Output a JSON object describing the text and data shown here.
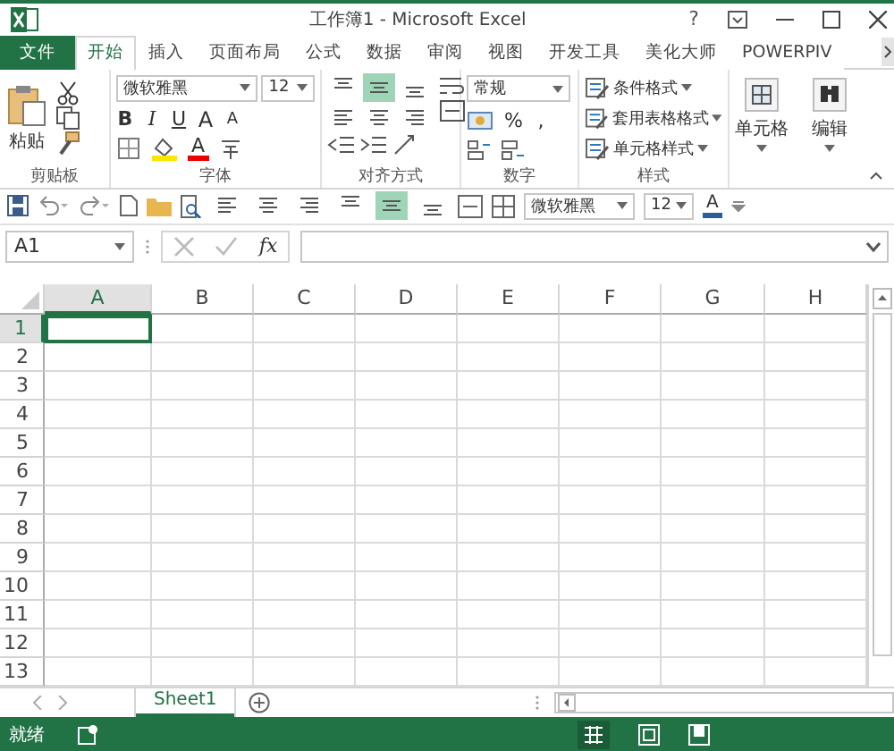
{
  "window": {
    "title": "工作簿1 - Microsoft Excel",
    "help": "?"
  },
  "tabs": [
    {
      "label": "文件",
      "kind": "file",
      "selected": false
    },
    {
      "label": "开始",
      "kind": "tab",
      "selected": true
    },
    {
      "label": "插入",
      "kind": "tab",
      "selected": false
    },
    {
      "label": "页面布局",
      "kind": "tab",
      "selected": false
    },
    {
      "label": "公式",
      "kind": "tab",
      "selected": false
    },
    {
      "label": "数据",
      "kind": "tab",
      "selected": false
    },
    {
      "label": "审阅",
      "kind": "tab",
      "selected": false
    },
    {
      "label": "视图",
      "kind": "tab",
      "selected": false
    },
    {
      "label": "开发工具",
      "kind": "tab",
      "selected": false
    },
    {
      "label": "美化大师",
      "kind": "tab",
      "selected": false
    },
    {
      "label": "POWERPIV",
      "kind": "tab",
      "selected": false
    }
  ],
  "ribbon": {
    "clipboard": {
      "paste": "粘贴",
      "label": "剪贴板"
    },
    "font": {
      "font_name": "微软雅黑",
      "font_size": "12",
      "bold": "B",
      "italic": "I",
      "underline": "U",
      "grow_font": "A",
      "shrink_font": "A",
      "font_color": "A",
      "label": "字体"
    },
    "alignment": {
      "buttons": [
        {
          "kind": "top",
          "selected": false
        },
        {
          "kind": "middle",
          "selected": true
        },
        {
          "kind": "bottom",
          "selected": false
        },
        {
          "kind": "left",
          "selected": false
        },
        {
          "kind": "center",
          "selected": false
        },
        {
          "kind": "right",
          "selected": false
        }
      ],
      "label": "对齐方式"
    },
    "number": {
      "format": "常规",
      "percent": "%",
      "comma": ",",
      "label": "数字"
    },
    "styles": {
      "items": [
        "条件格式",
        "套用表格格式",
        "单元格样式"
      ],
      "label": "样式"
    },
    "cells": {
      "label": "单元格"
    },
    "editing": {
      "label": "编辑"
    }
  },
  "quick_access": {
    "align_buttons": [
      {
        "kind": "left",
        "selected": false
      },
      {
        "kind": "center",
        "selected": false
      },
      {
        "kind": "right",
        "selected": false
      },
      {
        "kind": "top",
        "selected": false
      },
      {
        "kind": "middle",
        "selected": true
      },
      {
        "kind": "bottom",
        "selected": false
      }
    ],
    "font_name": "微软雅黑",
    "font_size": "12",
    "font_color": "A"
  },
  "formula_bar": {
    "name_box": "A1",
    "fx": "fx"
  },
  "sheet": {
    "columns": [
      {
        "label": "A",
        "selected": true
      },
      {
        "label": "B",
        "selected": false
      },
      {
        "label": "C",
        "selected": false
      },
      {
        "label": "D",
        "selected": false
      },
      {
        "label": "E",
        "selected": false
      },
      {
        "label": "F",
        "selected": false
      },
      {
        "label": "G",
        "selected": false
      },
      {
        "label": "H",
        "selected": false
      }
    ],
    "rows": [
      {
        "label": "1",
        "selected": true
      },
      {
        "label": "2",
        "selected": false
      },
      {
        "label": "3",
        "selected": false
      },
      {
        "label": "4",
        "selected": false
      },
      {
        "label": "5",
        "selected": false
      },
      {
        "label": "6",
        "selected": false
      },
      {
        "label": "7",
        "selected": false
      },
      {
        "label": "8",
        "selected": false
      },
      {
        "label": "9",
        "selected": false
      },
      {
        "label": "10",
        "selected": false
      },
      {
        "label": "11",
        "selected": false
      },
      {
        "label": "12",
        "selected": false
      },
      {
        "label": "13",
        "selected": false
      }
    ]
  },
  "sheet_tabs": [
    {
      "label": "Sheet1",
      "selected": true
    }
  ],
  "status_bar": {
    "text": "就绪"
  }
}
